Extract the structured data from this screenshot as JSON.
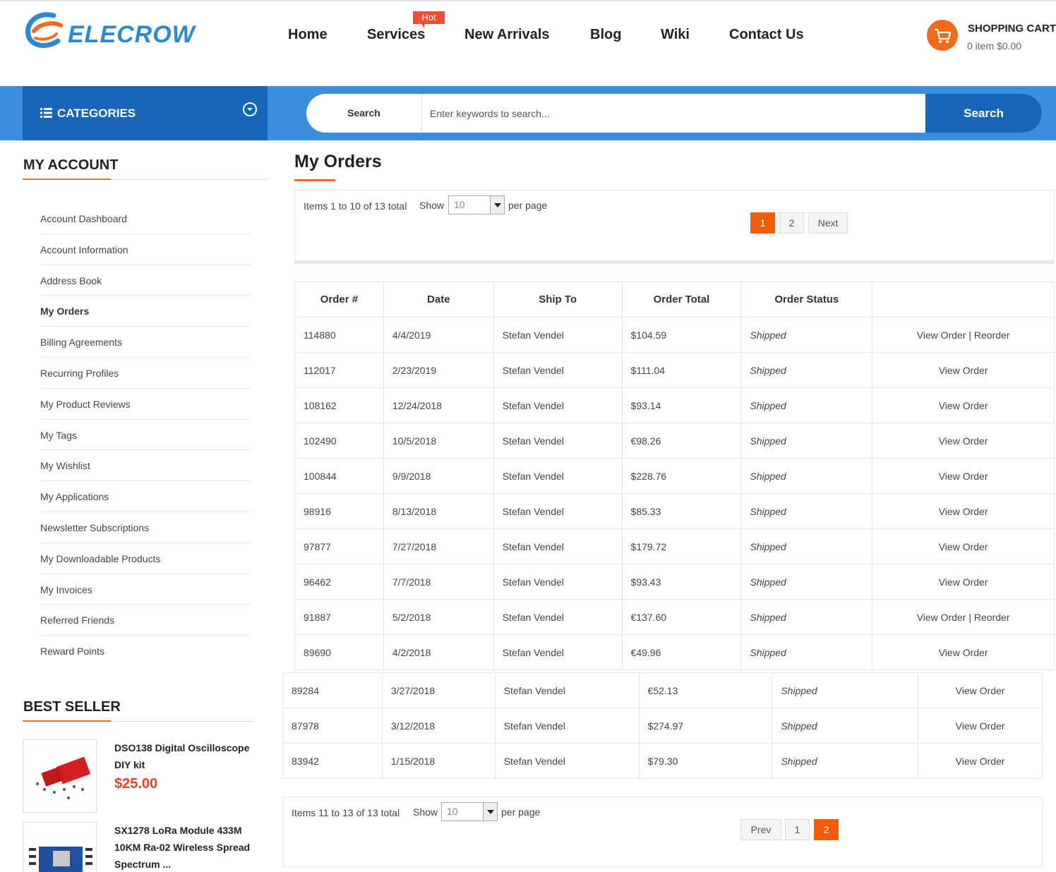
{
  "header": {
    "brand": "ELECROW",
    "nav": [
      "Home",
      "Services",
      "New Arrivals",
      "Blog",
      "Wiki",
      "Contact Us"
    ],
    "hot_badge": "Hot",
    "cart_title": "SHOPPING CART",
    "cart_summary": "0 item $0.00"
  },
  "searchbar": {
    "categories_label": "CATEGORIES",
    "scope_label": "Search",
    "placeholder": "Enter keywords to search...",
    "button_label": "Search"
  },
  "sidebar": {
    "account_heading": "MY ACCOUNT",
    "items": [
      "Account Dashboard",
      "Account Information",
      "Address Book",
      "My Orders",
      "Billing Agreements",
      "Recurring Profiles",
      "My Product Reviews",
      "My Tags",
      "My Wishlist",
      "My Applications",
      "Newsletter Subscriptions",
      "My Downloadable Products",
      "My Invoices",
      "Referred Friends",
      "Reward Points"
    ],
    "active_item": "My Orders",
    "bestseller_heading": "BEST SELLER",
    "products": [
      {
        "name_line1": "DSO138 Digital Oscilloscope",
        "name_line2": "DIY kit",
        "price": "$25.00"
      },
      {
        "name_line1": "SX1278 LoRa Module 433M",
        "name_line2": "10KM Ra-02 Wireless Spread",
        "name_line3": "Spectrum ..."
      }
    ]
  },
  "main": {
    "title": "My Orders",
    "pager_top": {
      "items_text": "Items 1 to 10 of 13 total",
      "show_label": "Show",
      "per_page_value": "10",
      "per_page_label": "per page",
      "pages": [
        "1",
        "2"
      ],
      "current_page": "1",
      "next_label": "Next"
    },
    "pager_bottom": {
      "items_text": "Items 11 to 13 of 13 total",
      "show_label": "Show",
      "per_page_value": "10",
      "per_page_label": "per page",
      "prev_label": "Prev",
      "pages": [
        "1",
        "2"
      ],
      "current_page": "2"
    },
    "columns": [
      "Order #",
      "Date",
      "Ship To",
      "Order Total",
      "Order Status",
      ""
    ],
    "orders_page1": [
      {
        "order": "114880",
        "date": "4/4/2019",
        "ship_to": "Stefan Vendel",
        "total": "$104.59",
        "status": "Shipped",
        "view": "View Order",
        "reorder": "Reorder"
      },
      {
        "order": "112017",
        "date": "2/23/2019",
        "ship_to": "Stefan Vendel",
        "total": "$111.04",
        "status": "Shipped",
        "view": "View Order",
        "reorder": ""
      },
      {
        "order": "108162",
        "date": "12/24/2018",
        "ship_to": "Stefan Vendel",
        "total": "$93.14",
        "status": "Shipped",
        "view": "View Order",
        "reorder": ""
      },
      {
        "order": "102490",
        "date": "10/5/2018",
        "ship_to": "Stefan Vendel",
        "total": "€98.26",
        "status": "Shipped",
        "view": "View Order",
        "reorder": ""
      },
      {
        "order": "100844",
        "date": "9/9/2018",
        "ship_to": "Stefan Vendel",
        "total": "$228.76",
        "status": "Shipped",
        "view": "View Order",
        "reorder": ""
      },
      {
        "order": "98916",
        "date": "8/13/2018",
        "ship_to": "Stefan Vendel",
        "total": "$85.33",
        "status": "Shipped",
        "view": "View Order",
        "reorder": ""
      },
      {
        "order": "97877",
        "date": "7/27/2018",
        "ship_to": "Stefan Vendel",
        "total": "$179.72",
        "status": "Shipped",
        "view": "View Order",
        "reorder": ""
      },
      {
        "order": "96462",
        "date": "7/7/2018",
        "ship_to": "Stefan Vendel",
        "total": "$93.43",
        "status": "Shipped",
        "view": "View Order",
        "reorder": ""
      },
      {
        "order": "91887",
        "date": "5/2/2018",
        "ship_to": "Stefan Vendel",
        "total": "€137.60",
        "status": "Shipped",
        "view": "View Order",
        "reorder": "Reorder"
      },
      {
        "order": "89690",
        "date": "4/2/2018",
        "ship_to": "Stefan Vendel",
        "total": "€49.96",
        "status": "Shipped",
        "view": "View Order",
        "reorder": ""
      }
    ],
    "orders_page2": [
      {
        "order": "89284",
        "date": "3/27/2018",
        "ship_to": "Stefan Vendel",
        "total": "€52.13",
        "status": "Shipped",
        "view": "View Order"
      },
      {
        "order": "87978",
        "date": "3/12/2018",
        "ship_to": "Stefan Vendel",
        "total": "$274.97",
        "status": "Shipped",
        "view": "View Order"
      },
      {
        "order": "83942",
        "date": "1/15/2018",
        "ship_to": "Stefan Vendel",
        "total": "$79.30",
        "status": "Shipped",
        "view": "View Order"
      }
    ]
  },
  "colors": {
    "accent": "#f26a1b",
    "pager_current": "#f25c05",
    "bar_blue": "#3b8ede",
    "dark_blue": "#1665b6",
    "price_red": "#e3412a",
    "hot_red": "#f04e36"
  }
}
